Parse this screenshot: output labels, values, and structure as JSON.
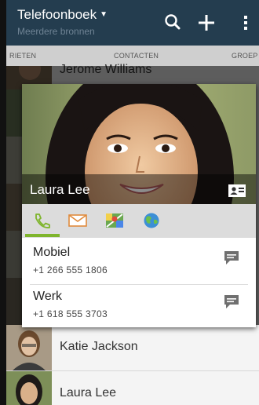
{
  "header": {
    "title": "Telefoonboek",
    "subtitle": "Meerdere bronnen"
  },
  "tabs": [
    {
      "label": "FAVORIETEN",
      "visible_label": "RIETEN"
    },
    {
      "label": "CONTACTEN"
    },
    {
      "label": "GROEPEN",
      "visible_label": "GROEP"
    }
  ],
  "list": {
    "top_name": "Jerome Williams",
    "rows": [
      {
        "name": "Katie Jackson"
      },
      {
        "name": "Laura Lee"
      }
    ]
  },
  "card": {
    "name": "Laura Lee",
    "entries": [
      {
        "label": "Mobiel",
        "number": "+1 266 555 1806"
      },
      {
        "label": "Werk",
        "number": "+1 618 555 3703"
      }
    ]
  },
  "colors": {
    "action_bar": "#243d4f",
    "active_tab_indicator": "#7fb52d"
  },
  "icons": [
    "search-icon",
    "add-icon",
    "overflow-menu-icon",
    "contact-card-icon",
    "phone-icon",
    "mail-icon",
    "map-icon",
    "globe-icon",
    "message-icon"
  ]
}
